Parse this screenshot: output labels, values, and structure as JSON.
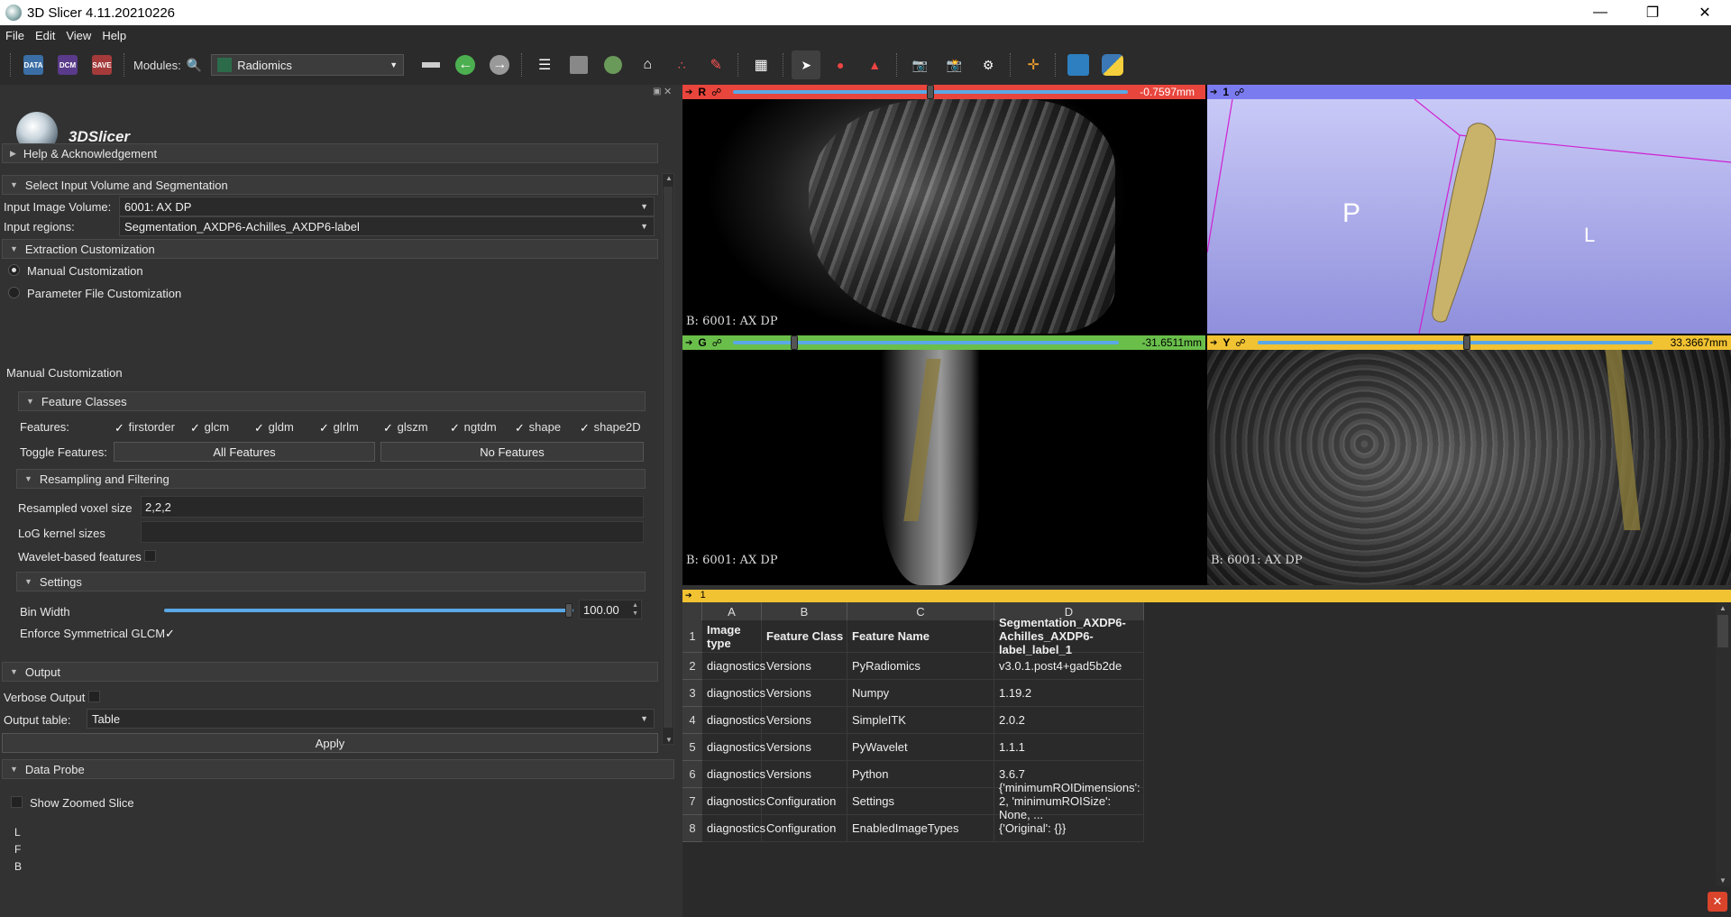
{
  "window": {
    "title": "3D Slicer 4.11.20210226"
  },
  "menu": [
    "File",
    "Edit",
    "View",
    "Help"
  ],
  "toolbar": {
    "data_label": "DATA",
    "dcm_label": "DCM",
    "save_label": "SAVE",
    "modules_label": "Modules:",
    "module_value": "Radiomics"
  },
  "logo": {
    "text": "3DSlicer"
  },
  "sections": {
    "help": "Help & Acknowledgement",
    "input": "Select Input Volume and Segmentation",
    "extraction": "Extraction Customization",
    "feature_classes": "Feature Classes",
    "resampling": "Resampling and Filtering",
    "settings": "Settings",
    "output": "Output",
    "data_probe": "Data Probe"
  },
  "input": {
    "volume_label": "Input Image Volume:",
    "volume_value": "6001: AX DP",
    "regions_label": "Input regions:",
    "regions_value": "Segmentation_AXDP6-Achilles_AXDP6-label"
  },
  "extraction": {
    "manual": "Manual Customization",
    "param": "Parameter File Customization",
    "manual_heading": "Manual Customization"
  },
  "features": {
    "label": "Features:",
    "items": [
      "firstorder",
      "glcm",
      "gldm",
      "glrlm",
      "glszm",
      "ngtdm",
      "shape",
      "shape2D"
    ],
    "toggle_label": "Toggle Features:",
    "all": "All Features",
    "none": "No Features"
  },
  "resampling": {
    "voxel_label": "Resampled voxel size",
    "voxel_value": "2,2,2",
    "log_label": "LoG kernel sizes",
    "log_value": "",
    "wavelet_label": "Wavelet-based features"
  },
  "settings": {
    "bin_label": "Bin Width",
    "bin_value": "100.00",
    "bin_fraction": 0.99,
    "sym_label": "Enforce Symmetrical GLCM"
  },
  "output": {
    "verbose_label": "Verbose Output",
    "table_label": "Output table:",
    "table_value": "Table",
    "apply": "Apply"
  },
  "probe": {
    "zoomed": "Show Zoomed Slice",
    "l": "L",
    "f": "F",
    "b": "B"
  },
  "views": {
    "red": {
      "tag": "R",
      "value": "-0.7597mm",
      "label": "B: 6001: AX DP",
      "slider": 0.5
    },
    "threed": {
      "tag": "1",
      "p": "P",
      "l": "L"
    },
    "green": {
      "tag": "G",
      "value": "-31.6511mm",
      "label": "B: 6001: AX DP",
      "slider": 0.16
    },
    "yellow": {
      "tag": "Y",
      "value": "33.3667mm",
      "label": "B: 6001: AX DP",
      "slider": 0.53
    }
  },
  "table_view": {
    "tag": "1"
  },
  "table": {
    "columns": [
      "A",
      "B",
      "C",
      "D"
    ],
    "rows": [
      [
        "1",
        "Image type",
        "Feature Class",
        "Feature Name",
        "Segmentation_AXDP6-Achilles_AXDP6-label_label_1"
      ],
      [
        "2",
        "diagnostics",
        "Versions",
        "PyRadiomics",
        "v3.0.1.post4+gad5b2de"
      ],
      [
        "3",
        "diagnostics",
        "Versions",
        "Numpy",
        "1.19.2"
      ],
      [
        "4",
        "diagnostics",
        "Versions",
        "SimpleITK",
        "2.0.2"
      ],
      [
        "5",
        "diagnostics",
        "Versions",
        "PyWavelet",
        "1.1.1"
      ],
      [
        "6",
        "diagnostics",
        "Versions",
        "Python",
        "3.6.7"
      ],
      [
        "7",
        "diagnostics",
        "Configuration",
        "Settings",
        "{'minimumROIDimensions': 2, 'minimumROISize': None, ..."
      ],
      [
        "8",
        "diagnostics",
        "Configuration",
        "EnabledImageTypes",
        "{'Original': {}}"
      ]
    ]
  },
  "colors": {
    "red": "#e8453c",
    "green": "#6abf4b",
    "yellow": "#f1c232",
    "threed": "#7b7bf0",
    "slider": "#5aa8e6"
  }
}
